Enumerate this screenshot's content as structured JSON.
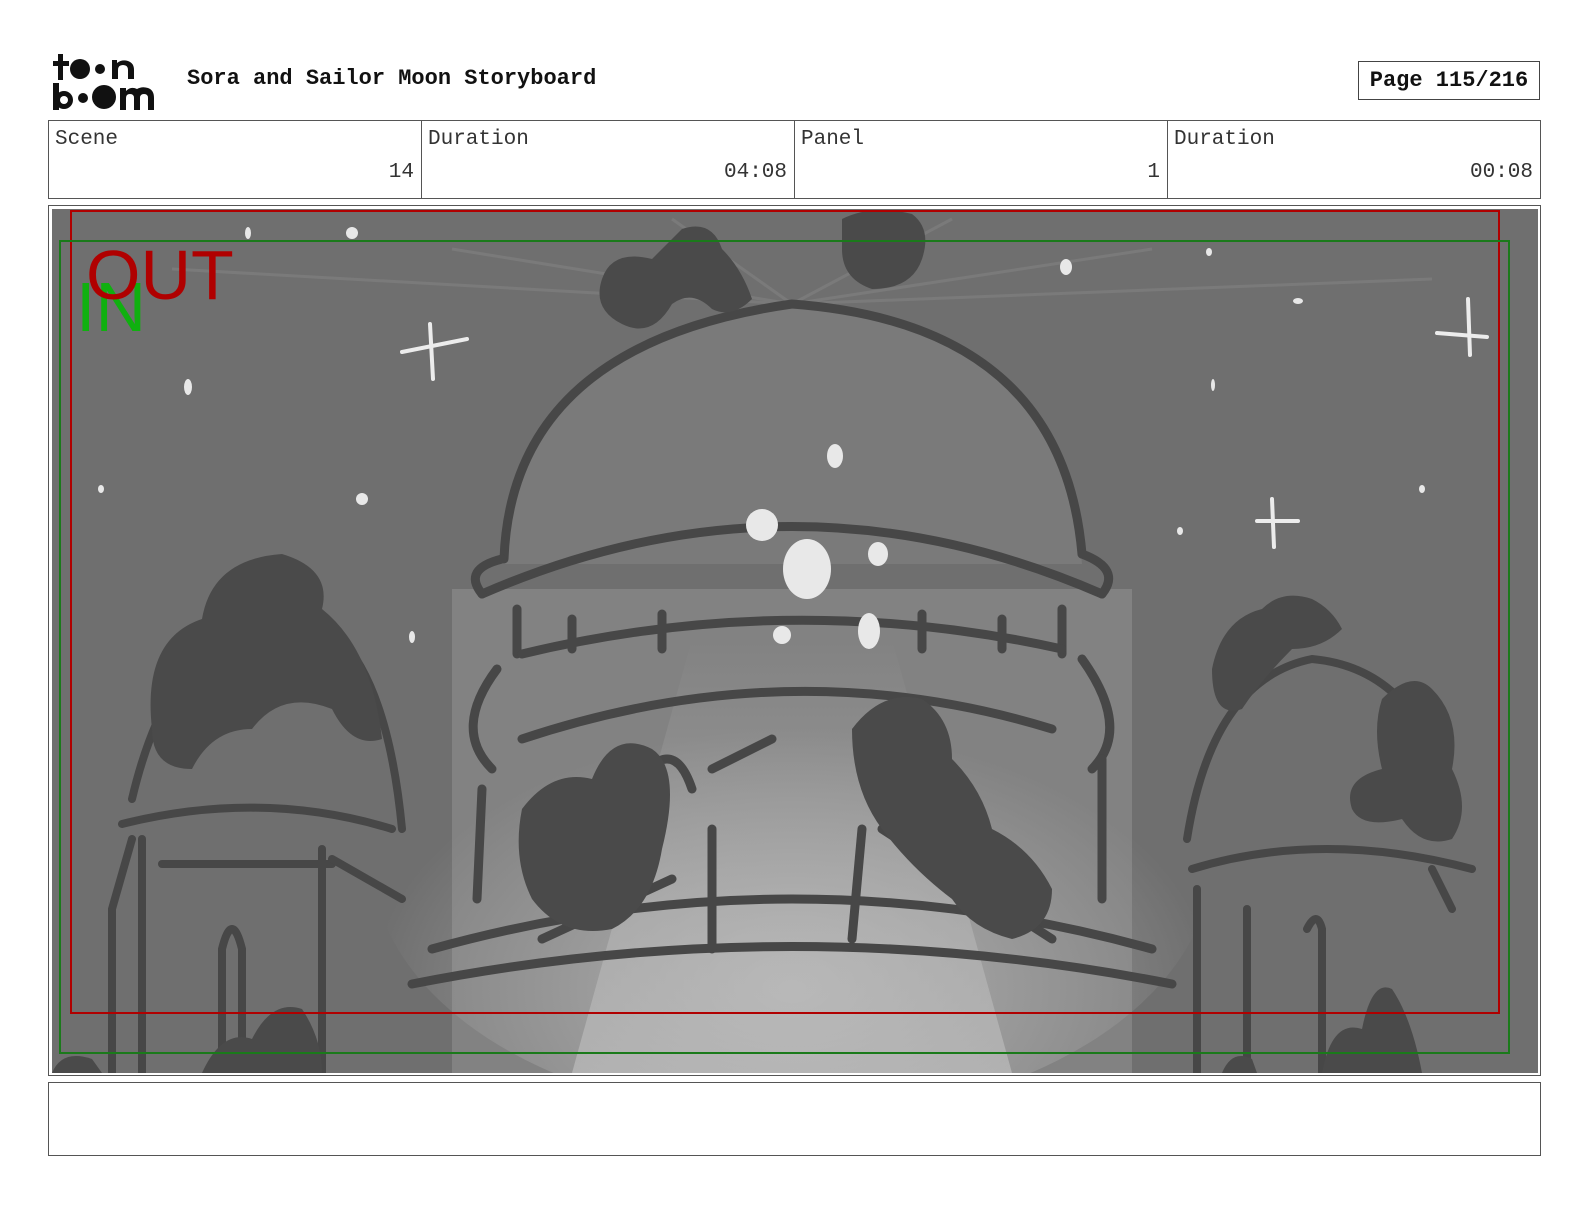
{
  "header": {
    "logo_text": "toon boom",
    "title": "Sora and Sailor Moon Storyboard",
    "page": "Page 115/216"
  },
  "info": {
    "scene_label": "Scene",
    "scene_value": "14",
    "scene_duration_label": "Duration",
    "scene_duration_value": "04:08",
    "panel_label": "Panel",
    "panel_value": "1",
    "panel_duration_label": "Duration",
    "panel_duration_value": "00:08"
  },
  "panel": {
    "out_marker": "OUT",
    "in_marker": "IN",
    "colors": {
      "out_frame": "#b00000",
      "in_frame": "#1a7a1a",
      "in_text": "#10b010",
      "sky": "#6f6f6f",
      "ink": "#454545",
      "highlight": "#e8e8e8"
    }
  },
  "notes": {
    "text": ""
  }
}
